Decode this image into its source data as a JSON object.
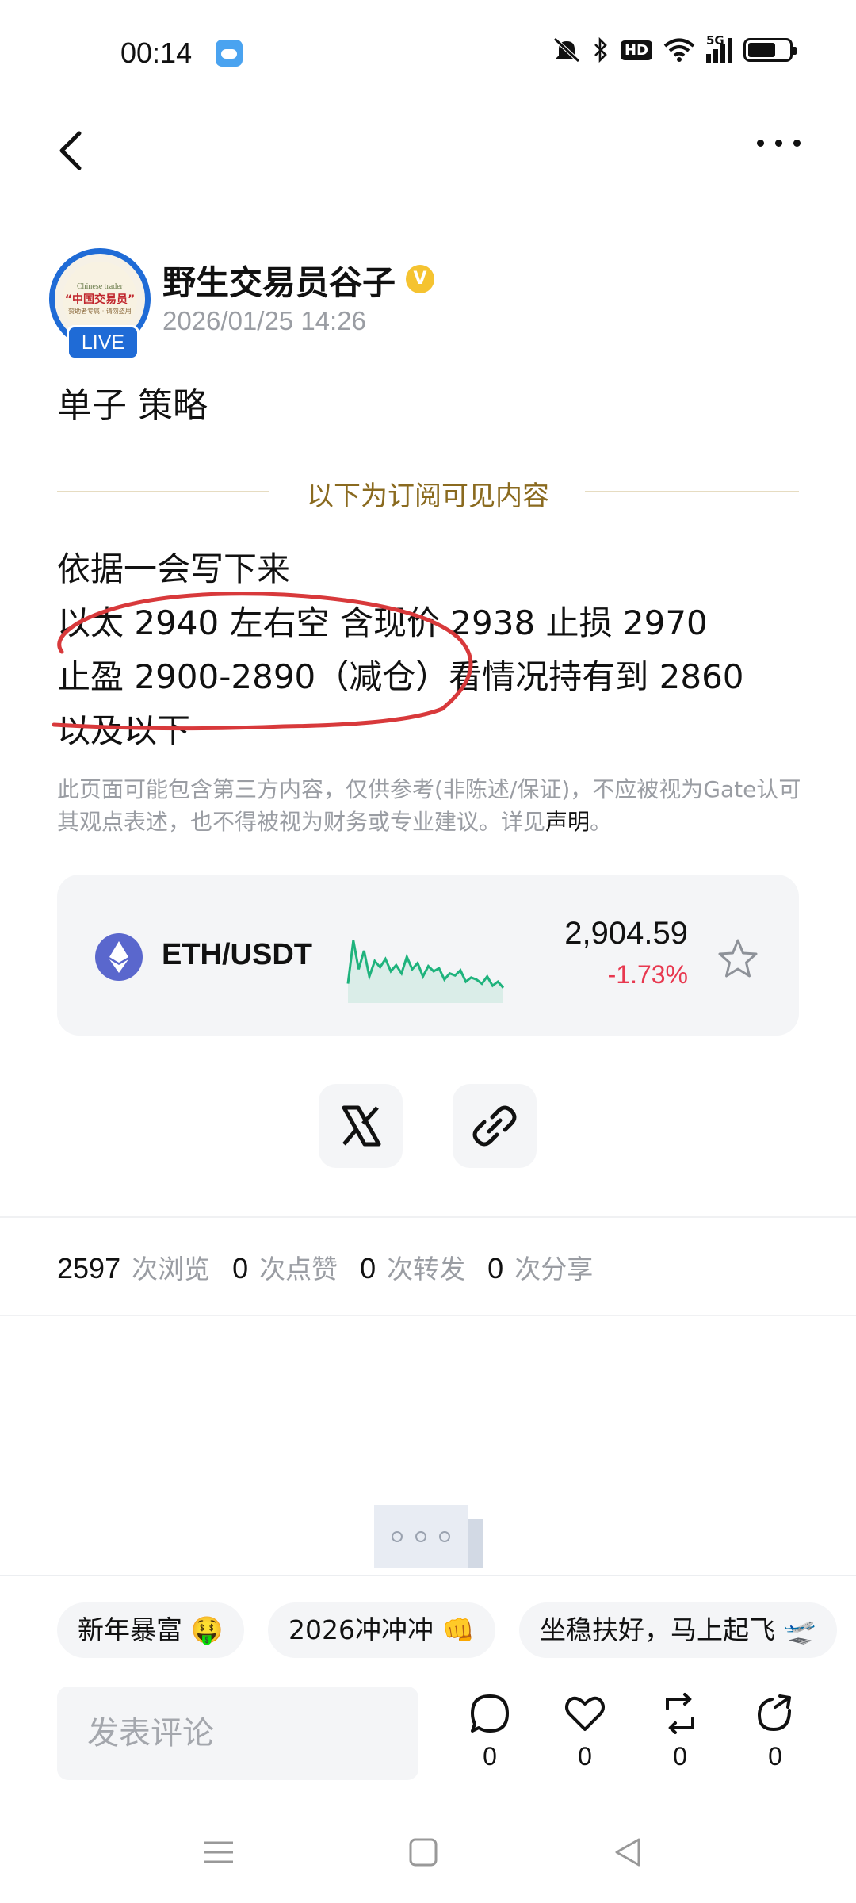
{
  "status_bar": {
    "time": "00:14",
    "hd": "HD",
    "net": "5G"
  },
  "author": {
    "name": "野生交易员谷子",
    "time": "2026/01/25 14:26",
    "live": "LIVE",
    "avatar_text": [
      "Chinese trader",
      "“中国交易员”",
      "赞助者专属 · 请勿盗用"
    ]
  },
  "post": {
    "title": "单子 策略",
    "subscription_label": "以下为订阅可见内容",
    "lines": [
      "依据一会写下来",
      "以太 2940 左右空 含现价 2938 止损 2970",
      "止盈 2900-2890（减仓）看情况持有到 2860",
      "以及以下"
    ],
    "disclaimer": "此页面可能包含第三方内容，仅供参考(非陈述/保证)，不应被视为Gate认可其观点表述，也不得被视为财务或专业建议。详见",
    "disclaimer_link": "声明",
    "disclaimer_end": "。"
  },
  "ticker": {
    "pair": "ETH/USDT",
    "price": "2,904.59",
    "change": "-1.73%",
    "change_color": "#e8384f",
    "sparkline": [
      62,
      20,
      48,
      30,
      55,
      40,
      46,
      38,
      50,
      44,
      52,
      36,
      48,
      42,
      55,
      45,
      50,
      47,
      58,
      52,
      54,
      49,
      60,
      56,
      58,
      62,
      55,
      64,
      60,
      66
    ]
  },
  "stats": [
    {
      "num": "2597",
      "label": "次浏览"
    },
    {
      "num": "0",
      "label": "次点赞"
    },
    {
      "num": "0",
      "label": "次转发"
    },
    {
      "num": "0",
      "label": "次分享"
    }
  ],
  "chips": [
    "新年暴富 🤑",
    "2026冲冲冲 👊",
    "坐稳扶好，马上起飞 🛫"
  ],
  "comment_placeholder": "发表评论",
  "actions": [
    {
      "icon": "comment-icon",
      "count": "0"
    },
    {
      "icon": "heart-icon",
      "count": "0"
    },
    {
      "icon": "repost-icon",
      "count": "0"
    },
    {
      "icon": "share-icon",
      "count": "0"
    }
  ],
  "colors": {
    "accent_blue": "#1f6bd6",
    "gold": "#8a6a1f",
    "red": "#e8384f",
    "green": "#1fb37d"
  }
}
